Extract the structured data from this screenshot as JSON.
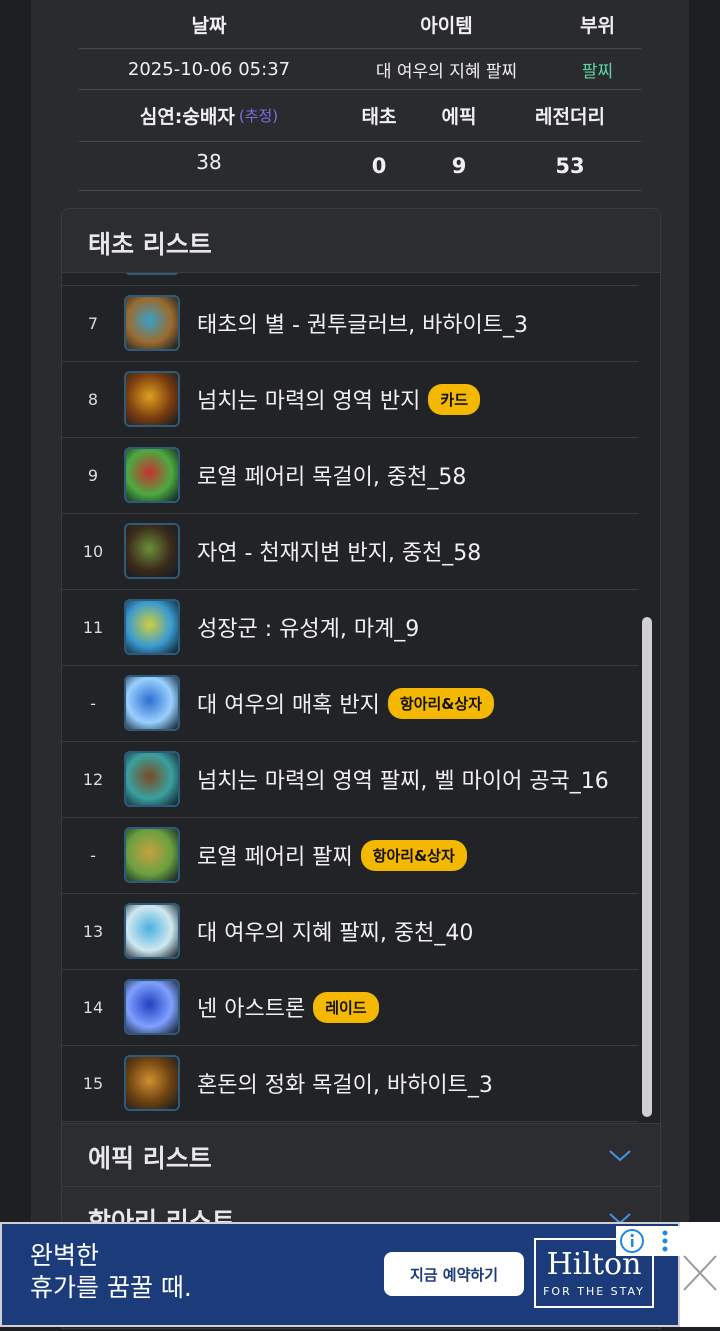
{
  "info": {
    "headers": {
      "date": "날짜",
      "item": "아이템",
      "part": "부위"
    },
    "date": "2025-10-06 05:37",
    "item": "대 여우의 지혜 팔찌",
    "part": "팔찌",
    "stats_headers": {
      "depth": "심연:숭배자",
      "estimate": "(추정)",
      "primeval": "태초",
      "epic": "에픽",
      "legendary": "레전더리"
    },
    "stats": {
      "depth": "38",
      "primeval": "0",
      "epic": "9",
      "legendary": "53"
    }
  },
  "panel": {
    "title": "태초 리스트"
  },
  "items": [
    {
      "num": "7",
      "name": "태초의 별 - 권투글러브, 바하이트_3",
      "badge": "",
      "colors": [
        "#3aa0c8",
        "#9b6b2e"
      ]
    },
    {
      "num": "8",
      "name": "넘치는 마력의 영역 반지",
      "badge": "카드",
      "colors": [
        "#e0a020",
        "#7a3c10"
      ]
    },
    {
      "num": "9",
      "name": "로열 페어리 목걸이, 중천_58",
      "badge": "",
      "colors": [
        "#c83030",
        "#4caa40"
      ]
    },
    {
      "num": "10",
      "name": "자연 - 천재지변 반지, 중천_58",
      "badge": "",
      "colors": [
        "#6b8f3a",
        "#3b2a1a"
      ]
    },
    {
      "num": "11",
      "name": "성장군 : 유성계, 마계_9",
      "badge": "",
      "colors": [
        "#cfcf40",
        "#3a9ad0"
      ]
    },
    {
      "num": "-",
      "name": "대 여우의 매혹 반지",
      "badge": "항아리&상자",
      "colors": [
        "#2d6fd0",
        "#9ad0ff"
      ]
    },
    {
      "num": "12",
      "name": "넘치는 마력의 영역 팔찌, 벨 마이어 공국_16",
      "badge": "",
      "colors": [
        "#7a4a20",
        "#3aa0a0"
      ]
    },
    {
      "num": "-",
      "name": "로열 페어리 팔찌",
      "badge": "항아리&상자",
      "colors": [
        "#c8a040",
        "#6aa040"
      ]
    },
    {
      "num": "13",
      "name": "대 여우의 지혜 팔찌, 중천_40",
      "badge": "",
      "colors": [
        "#4ab0e0",
        "#d0e8f0"
      ]
    },
    {
      "num": "14",
      "name": "넨 아스트론",
      "badge": "레이드",
      "colors": [
        "#2040c0",
        "#80a0ff"
      ]
    },
    {
      "num": "15",
      "name": "혼돈의 정화 목걸이, 바하이트_3",
      "badge": "",
      "colors": [
        "#d09030",
        "#6a4010"
      ]
    }
  ],
  "sections": [
    {
      "title": "에픽 리스트"
    },
    {
      "title": "항아리 리스트"
    }
  ],
  "ad": {
    "text": "완벽한\n휴가를 꿈꿀 때.",
    "button": "지금 예약하기",
    "brand": "Hilton",
    "tagline": "FOR THE STAY"
  }
}
